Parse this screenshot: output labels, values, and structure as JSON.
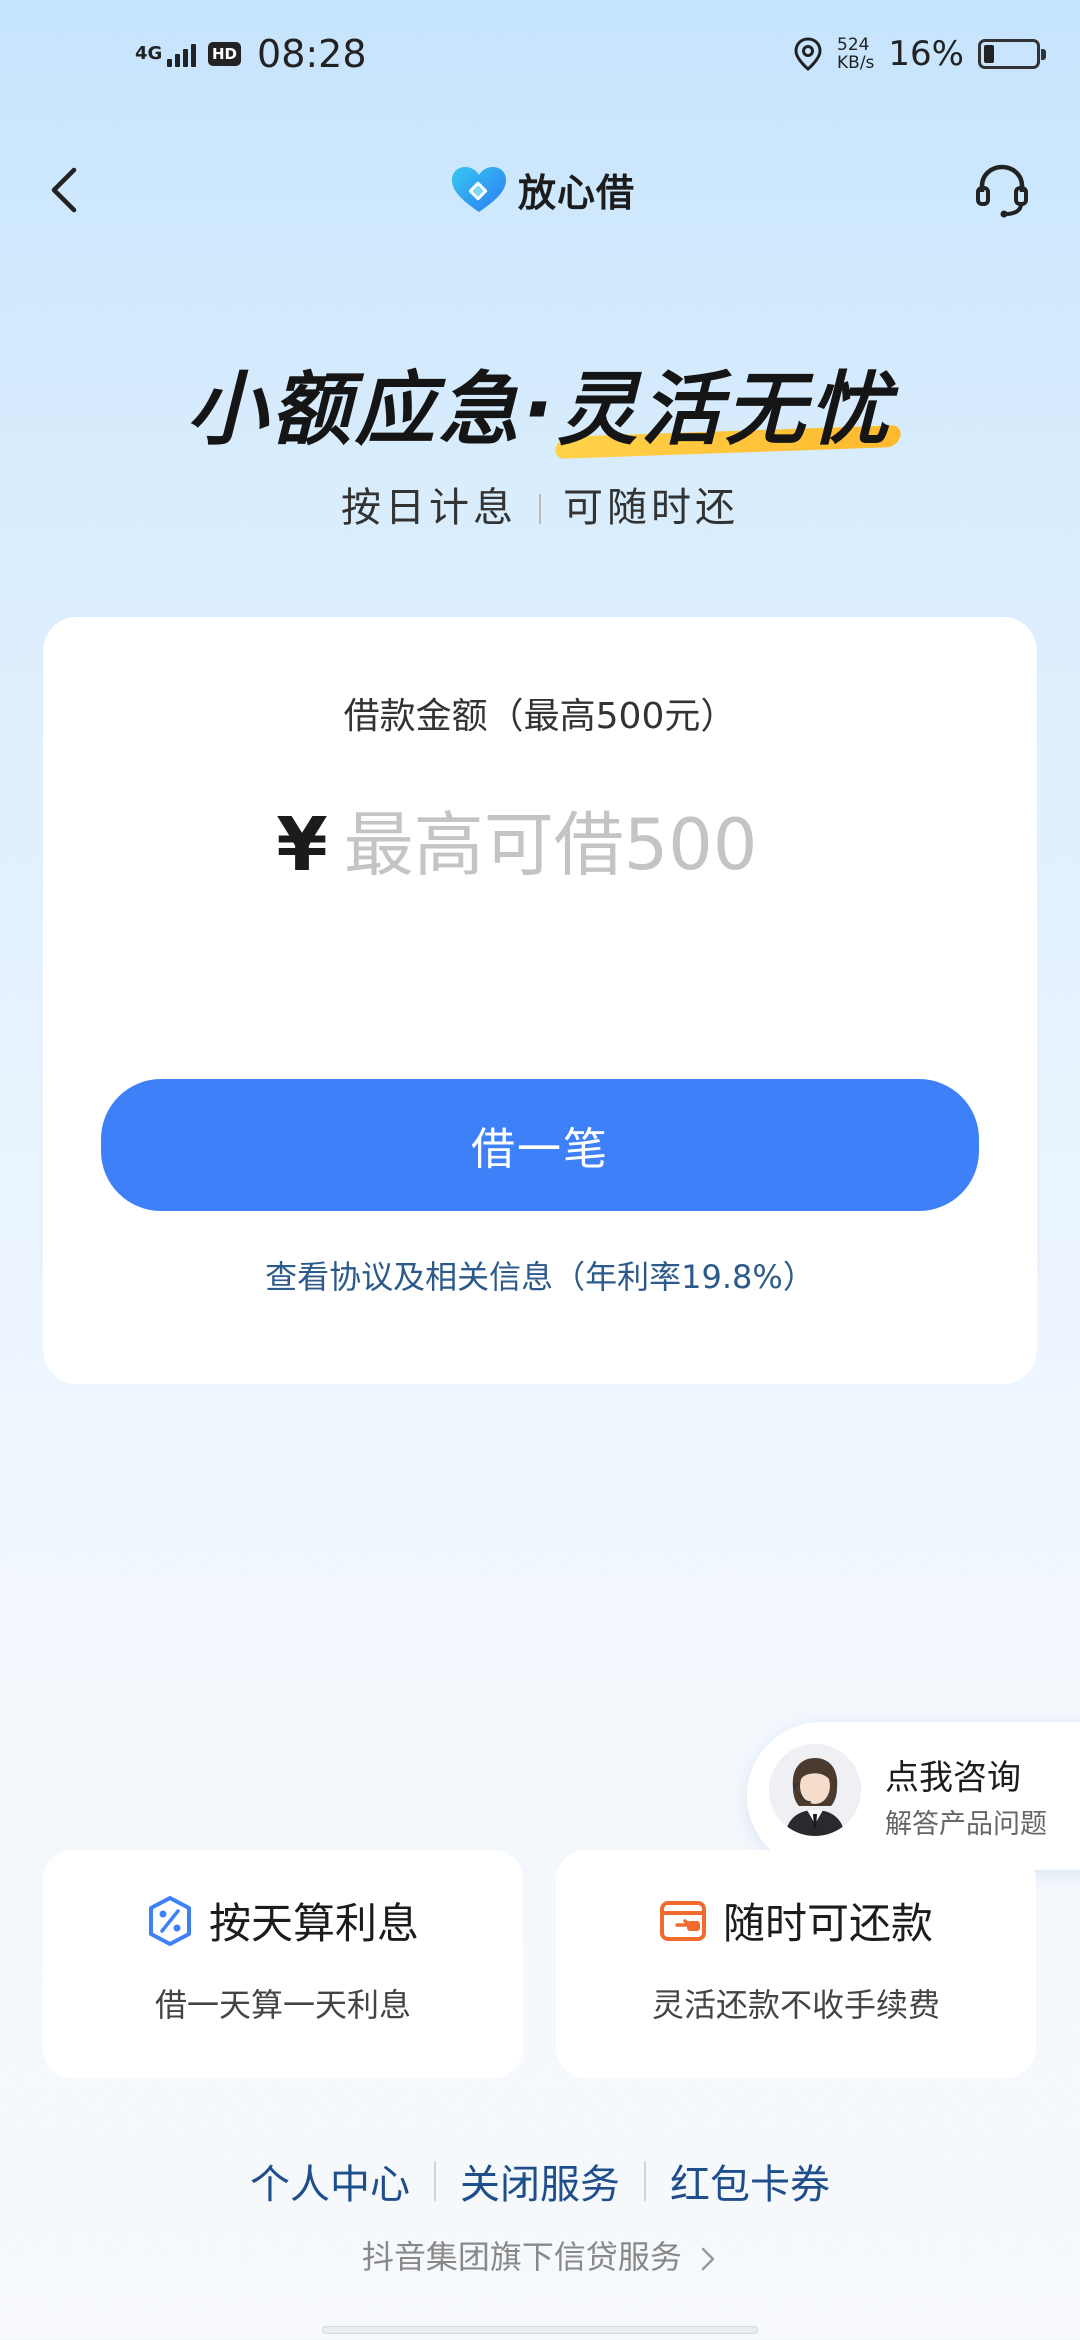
{
  "status_bar": {
    "network": "4G",
    "hd": "HD",
    "time": "08:28",
    "speed_value": "524",
    "speed_unit": "KB/s",
    "battery": "16%",
    "battery_level": 0.16
  },
  "nav": {
    "brand_name": "放心借"
  },
  "hero": {
    "title_part1": "小额应急·",
    "title_part2": "灵活无忧",
    "sub_part1": "按日计息",
    "sub_part2": "可随时还"
  },
  "loan_card": {
    "amount_label": "借款金额（最高500元）",
    "currency_symbol": "¥",
    "amount_placeholder": "最高可借500",
    "borrow_button": "借一笔",
    "agreement_link": "查看协议及相关信息（年利率19.8%）"
  },
  "consult": {
    "title": "点我咨询",
    "subtitle": "解答产品问题"
  },
  "features": [
    {
      "title": "按天算利息",
      "desc": "借一天算一天利息",
      "icon": "percent-icon",
      "color": "#3e80f7"
    },
    {
      "title": "随时可还款",
      "desc": "灵活还款不收手续费",
      "icon": "repay-card-icon",
      "color": "#f26b2e"
    }
  ],
  "bottom_links": [
    "个人中心",
    "关闭服务",
    "红包卡券"
  ],
  "group_service": "抖音集团旗下信贷服务",
  "colors": {
    "primary": "#3e80f7",
    "accent_orange": "#f26b2e",
    "highlight_yellow": "#ffc83a",
    "link_blue": "#1f4e8c"
  }
}
